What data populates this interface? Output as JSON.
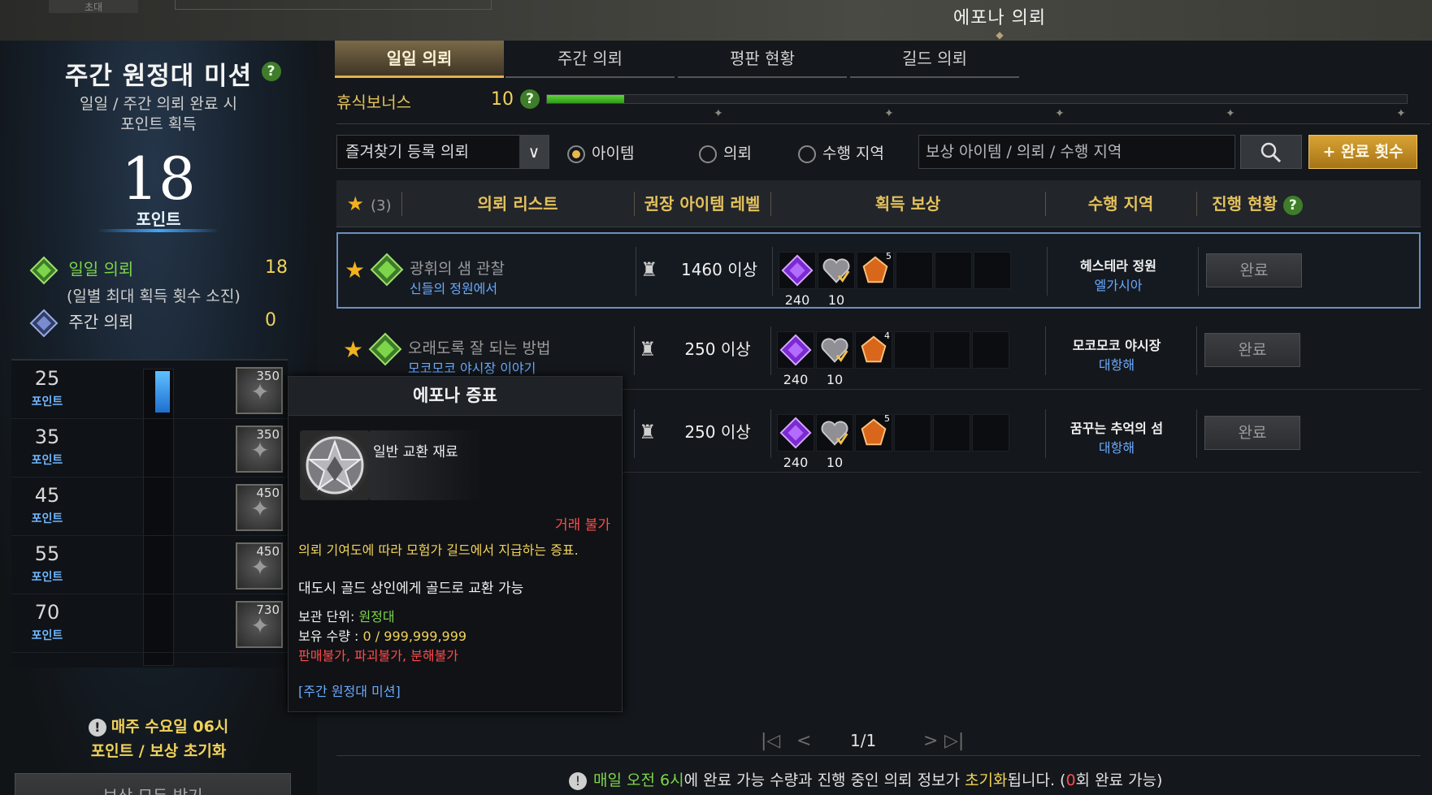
{
  "window": {
    "title": "에포나 의뢰",
    "corner_tab": "초대"
  },
  "left": {
    "title": "주간 원정대 미션",
    "subtitle_line1": "일일 / 주간 의뢰 완료 시",
    "subtitle_line2": "포인트 획득",
    "points": "18",
    "points_label": "포인트",
    "daily_label": "일일 의뢰",
    "daily_value": "18",
    "daily_sub": "(일별 최대 획득 횟수 소진)",
    "weekly_label": "주간 의뢰",
    "weekly_value": "0",
    "progress_fraction": 0.14,
    "tiers": [
      {
        "points": "25",
        "label": "포인트",
        "count": "350"
      },
      {
        "points": "35",
        "label": "포인트",
        "count": "350"
      },
      {
        "points": "45",
        "label": "포인트",
        "count": "450"
      },
      {
        "points": "55",
        "label": "포인트",
        "count": "450"
      },
      {
        "points": "70",
        "label": "포인트",
        "count": "730"
      }
    ],
    "reset_line1": "매주 수요일 06시",
    "reset_line2": "포인트 / 보상 초기화",
    "claim_all": "보상 모두 받기"
  },
  "tabs": [
    {
      "label": "일일 의뢰",
      "active": true
    },
    {
      "label": "주간 의뢰",
      "active": false
    },
    {
      "label": "평판 현황",
      "active": false
    },
    {
      "label": "길드 의뢰",
      "active": false
    }
  ],
  "rest_bonus": {
    "label": "휴식보너스",
    "value": "10",
    "fill_fraction": 0.09
  },
  "filters": {
    "dropdown_value": "즐겨찾기 등록 의뢰",
    "radio_item": "아이템",
    "radio_quest": "의뢰",
    "radio_region": "수행 지역",
    "selected_radio": "아이템",
    "search_placeholder": "보상 아이템 / 의뢰 / 수행 지역",
    "complete_count_button": "+ 완료 횟수"
  },
  "table": {
    "fav_count": "(3)",
    "col_list": "의뢰 리스트",
    "col_level": "권장 아이템 레벨",
    "col_reward": "획득 보상",
    "col_region": "수행 지역",
    "col_status": "진행 현황",
    "rows": [
      {
        "name": "광휘의 샘 관찰",
        "sub": "신들의 정원에서",
        "level": "1460 이상",
        "r1": "240",
        "r2": "10",
        "r3badge": "5",
        "region": "헤스테라 정원",
        "region_sub": "엘가시아",
        "status": "완료"
      },
      {
        "name": "오래도록 잘 되는 방법",
        "sub": "모코모코 야시장 이야기",
        "level": "250 이상",
        "r1": "240",
        "r2": "10",
        "r3badge": "4",
        "region": "모코모코 야시장",
        "region_sub": "대항해",
        "status": "완료"
      },
      {
        "name": "",
        "sub": "",
        "level": "250 이상",
        "r1": "240",
        "r2": "10",
        "r3badge": "5",
        "region": "꿈꾸는 추억의 섬",
        "region_sub": "대항해",
        "status": "완료"
      }
    ]
  },
  "pager": {
    "page": "1/1"
  },
  "footer": {
    "part1": "매일 오전 6시",
    "part2": "에 완료 가능 수량과 진행 중인 의뢰 정보가 ",
    "part3": "초기화",
    "part4": "됩니다. (",
    "part5": "0",
    "part6": "회 완료 가능)"
  },
  "tooltip": {
    "title": "에포나 증표",
    "type": "일반 교환 재료",
    "trade": "거래 불가",
    "desc": "의뢰 기여도에 따라 모험가 길드에서 지급하는 증표.",
    "exchange": "대도시 골드 상인에게 골드로 교환 가능",
    "storage_label": "보관 단위: ",
    "storage_value": "원정대",
    "owned_label": "보유 수량 : ",
    "owned_value": "0 / 999,999,999",
    "limit1": "판매불가",
    "limit2": "파괴불가",
    "limit3": "분해불가",
    "source": "[주간 원정대 미션]"
  },
  "colors": {
    "accent": "#e3c15d",
    "green": "#7dd64a",
    "blue": "#6aaaff",
    "red": "#ff4b4b",
    "gold_button": "#d8a334"
  }
}
